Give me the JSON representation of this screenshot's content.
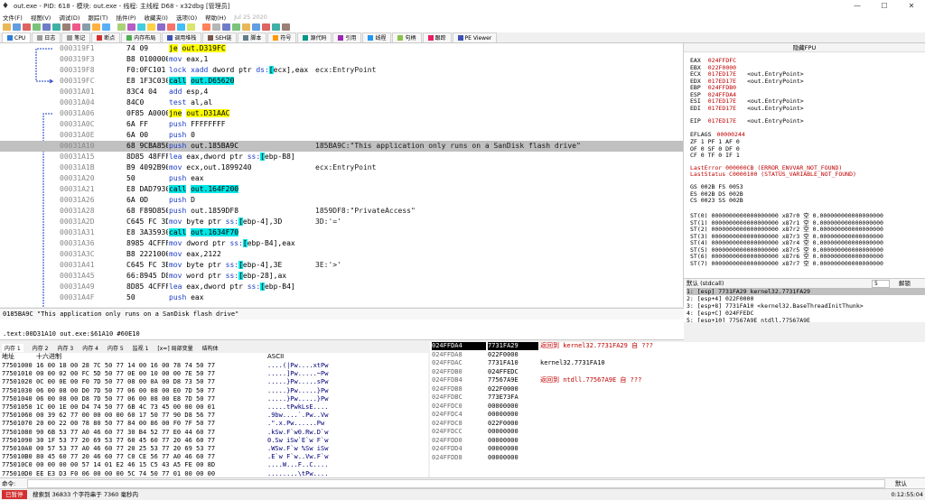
{
  "window": {
    "title": "out.exe - PID: 618 - 模块: out.exe - 线程: 主线程 D68 - x32dbg [管理员]",
    "controls": [
      "—",
      "☐",
      "✕"
    ]
  },
  "menu": {
    "items": [
      "文件(F)",
      "视图(V)",
      "调试(D)",
      "跟踪(T)",
      "插件(P)",
      "收藏夹(I)",
      "选项(O)",
      "帮助(H)"
    ],
    "date": "Jul 25 2020"
  },
  "tabs": [
    {
      "label": "CPU",
      "color": "#2e7dd7"
    },
    {
      "label": "日志",
      "color": "#9a9a9a"
    },
    {
      "label": "笔记",
      "color": "#9a9a9a"
    },
    {
      "label": "断点",
      "color": "#d32f2f"
    },
    {
      "label": "内存布局",
      "color": "#4caf50"
    },
    {
      "label": "调用堆栈",
      "color": "#3f51b5"
    },
    {
      "label": "SEH链",
      "color": "#795548"
    },
    {
      "label": "脚本",
      "color": "#607d8b"
    },
    {
      "label": "符号",
      "color": "#ff9800"
    },
    {
      "label": "源代码",
      "color": "#009688"
    },
    {
      "label": "引用",
      "color": "#9c27b0"
    },
    {
      "label": "线程",
      "color": "#2196f3"
    },
    {
      "label": "句柄",
      "color": "#8bc34a"
    },
    {
      "label": "跟踪",
      "color": "#e91e63"
    },
    {
      "label": "PE Viewer",
      "color": "#3f51b5"
    }
  ],
  "disasm": [
    {
      "addr": "000319F1",
      "bytes": "74 09",
      "instr": "je out.D319FC",
      "cmt": ""
    },
    {
      "addr": "000319F3",
      "bytes": "B8 01000000",
      "instr": "mov eax,1",
      "cmt": ""
    },
    {
      "addr": "000319F8",
      "bytes": "F0:0FC101",
      "instr": "lock xadd dword ptr ds:[ecx],eax",
      "cmt": "ecx:EntryPoint"
    },
    {
      "addr": "000319FC",
      "bytes": "E8 1F3C0300",
      "instr": "call out.D65620",
      "cmt": ""
    },
    {
      "addr": "00031A01",
      "bytes": "83C4 04",
      "instr": "add esp,4",
      "cmt": ""
    },
    {
      "addr": "00031A04",
      "bytes": "84C0",
      "instr": "test al,al",
      "cmt": ""
    },
    {
      "addr": "00031A06",
      "bytes": "0F85 A0000000",
      "instr": "jne out.D31AAC",
      "cmt": ""
    },
    {
      "addr": "00031A0C",
      "bytes": "6A FF",
      "instr": "push FFFFFFFF",
      "cmt": ""
    },
    {
      "addr": "00031A0E",
      "bytes": "6A 00",
      "instr": "push 0",
      "cmt": ""
    },
    {
      "addr": "00031A10",
      "bytes": "68 9CBA8500",
      "instr": "push out.185BA9C",
      "cmt": "185BA9C:\"This application only runs on a SanDisk flash drive\""
    },
    {
      "addr": "00031A15",
      "bytes": "8D85 48FFFFFF",
      "instr": "lea eax,dword ptr ss:[ebp-B8]",
      "cmt": ""
    },
    {
      "addr": "00031A1B",
      "bytes": "B9 4092B901",
      "instr": "mov ecx,out.1899240",
      "cmt": "ecx:EntryPoint"
    },
    {
      "addr": "00031A20",
      "bytes": "50",
      "instr": "push eax",
      "cmt": ""
    },
    {
      "addr": "00031A21",
      "bytes": "E8 DAD79300",
      "instr": "call out.164F200",
      "cmt": ""
    },
    {
      "addr": "00031A26",
      "bytes": "6A 0D",
      "instr": "push D",
      "cmt": ""
    },
    {
      "addr": "00031A28",
      "bytes": "68 F89D8501",
      "instr": "push out.1859DF8",
      "cmt": "1859DF8:\"PrivateAccess\""
    },
    {
      "addr": "00031A2D",
      "bytes": "C645 FC 3D",
      "instr": "mov byte ptr ss:[ebp-4],3D",
      "cmt": "3D:'='"
    },
    {
      "addr": "00031A31",
      "bytes": "E8 3A359300",
      "instr": "call out.1634F70",
      "cmt": ""
    },
    {
      "addr": "00031A36",
      "bytes": "8985 4CFFFFFF",
      "instr": "mov dword ptr ss:[ebp-B4],eax",
      "cmt": ""
    },
    {
      "addr": "00031A3C",
      "bytes": "B8 22210000",
      "instr": "mov eax,2122",
      "cmt": ""
    },
    {
      "addr": "00031A41",
      "bytes": "C645 FC 3E",
      "instr": "mov byte ptr ss:[ebp-4],3E",
      "cmt": "3E:'>'"
    },
    {
      "addr": "00031A45",
      "bytes": "66:8945 D8",
      "instr": "mov word ptr ss:[ebp-28],ax",
      "cmt": ""
    },
    {
      "addr": "00031A49",
      "bytes": "8D85 4CFFFFFF",
      "instr": "lea eax,dword ptr ss:[ebp-B4]",
      "cmt": ""
    },
    {
      "addr": "00031A4F",
      "bytes": "50",
      "instr": "push eax",
      "cmt": ""
    }
  ],
  "registers": {
    "header": "隐藏FPU",
    "gp": [
      {
        "name": "EAX",
        "value": "024FFDFC",
        "label": ""
      },
      {
        "name": "EBX",
        "value": "022F0000",
        "label": ""
      },
      {
        "name": "ECX",
        "value": "017ED17E",
        "label": "<out.EntryPoint>"
      },
      {
        "name": "EDX",
        "value": "017ED17E",
        "label": "<out.EntryPoint>"
      },
      {
        "name": "EBP",
        "value": "024FFDB0",
        "label": ""
      },
      {
        "name": "ESP",
        "value": "024FFDA4",
        "label": ""
      },
      {
        "name": "ESI",
        "value": "017ED17E",
        "label": "<out.EntryPoint>"
      },
      {
        "name": "EDI",
        "value": "017ED17E",
        "label": "<out.EntryPoint>"
      }
    ],
    "eip": {
      "name": "EIP",
      "value": "017ED17E",
      "label": "<out.EntryPoint>"
    },
    "eflags": {
      "name": "EFLAGS",
      "value": "00000244"
    },
    "flags": [
      "ZF 1  PF 1  AF 0",
      "OF 0  SF 0  DF 0",
      "CF 0  TF 0  IF 1"
    ],
    "lasterror": "LastError  000000CB (ERROR_ENVVAR_NOT_FOUND)",
    "laststatus": "LastStatus C0000100 (STATUS_VARIABLE_NOT_FOUND)",
    "segs": [
      "GS 002B  FS 0053",
      "ES 002B  DS 002B",
      "CS 0023  SS 002B"
    ],
    "fpu": [
      "ST(0) 0000000000000000000 x87r0 空 0.000000000000000000",
      "ST(1) 0000000000000000000 x87r1 空 0.000000000000000000",
      "ST(2) 0000000000000000000 x87r2 空 0.000000000000000000",
      "ST(3) 0000000000000000000 x87r3 空 0.000000000000000000",
      "ST(4) 0000000000000000000 x87r4 空 0.000000000000000000",
      "ST(5) 0000000000000000000 x87r5 空 0.000000000000000000",
      "ST(6) 0000000000000000000 x87r6 空 0.000000000000000000",
      "ST(7) 0000000000000000000 x87r7 空 0.000000000000000000"
    ]
  },
  "callstack": {
    "header": "默认 (stdcall)",
    "count": "5",
    "unlock": "解锁",
    "rows": [
      "1: [esp] 7731FA29 kernel32.7731FA29",
      "2: [esp+4] 022F0000",
      "3: [esp+8] 7731FA10 <kernel32.BaseThreadInitThunk>",
      "4: [esp+C] 024FFEDC",
      "5: [esp+10] 77567A9E ntdll.77567A9E"
    ]
  },
  "info": {
    "line1": "0185BA9C \"This application only runs on a SanDisk flash drive\"",
    "line2": ".text:00D31A10 out.exe:$61A10 #60E10"
  },
  "dump_tabs": [
    "内存 1",
    "内存 2",
    "内存 3",
    "内存 4",
    "内存 5",
    "监视 1",
    "[x=] 局部变量",
    "结构体"
  ],
  "dump": {
    "col_addr": "地址",
    "col_hex": "十六进制",
    "col_ascii": "ASCII",
    "rows": [
      {
        "a": "77501000",
        "h": "16 00 18 00 28 7C 50 77 14 00 16 00 78 74 50 77",
        "s": "....(|Pw....xtPw"
      },
      {
        "a": "77501010",
        "h": "00 00 02 00 FC 5D 50 77 0E 00 10 00 00 7E 50 77",
        "s": ".....]Pw.....~Pw"
      },
      {
        "a": "77501020",
        "h": "0C 00 0E 00 F0 7D 50 77 08 00 0A 00 D8 73 50 77",
        "s": ".....}Pw.....sPw"
      },
      {
        "a": "77501030",
        "h": "06 00 08 00 D0 7D 50 77 06 00 08 00 E0 7D 50 77",
        "s": ".....}Pw.....}Pw"
      },
      {
        "a": "77501040",
        "h": "06 00 08 00 D8 7D 50 77 06 00 08 00 E8 7D 50 77",
        "s": ".....}Pw.....}Pw"
      },
      {
        "a": "77501050",
        "h": "1C 00 1E 00 D4 74 50 77 6B 4C 73 45 00 00 00 01",
        "s": ".....tPwkLsE...."
      },
      {
        "a": "77501060",
        "h": "00 39 62 77 00 00 00 00 60 17 50 77 90 D8 56 77",
        "s": ".9bw....`.Pw..Vw"
      },
      {
        "a": "77501070",
        "h": "20 00 22 00 78 80 50 77 84 00 86 00 F0 7F 50 77",
        "s": " .\".x.Pw......Pw"
      },
      {
        "a": "77501080",
        "h": "90 6B 53 77 A0 46 60 77 30 B4 52 77 E0 44 60 77",
        "s": ".kSw.F`w0.Rw.D`w"
      },
      {
        "a": "77501090",
        "h": "30 1F 53 77 20 69 53 77 60 45 60 77 20 46 60 77",
        "s": "0.Sw iSw`E`w F`w"
      },
      {
        "a": "775010A0",
        "h": "00 57 53 77 A0 46 60 77 20 25 53 77 20 69 53 77",
        "s": ".WSw.F`w %Sw iSw"
      },
      {
        "a": "775010B0",
        "h": "80 45 60 77 20 46 60 77 C0 CE 56 77 A0 46 60 77",
        "s": ".E`w F`w..Vw.F`w"
      },
      {
        "a": "775010C0",
        "h": "00 00 00 00 57 14 01 E2 46 15 C5 43 A5 FE 00 8D",
        "s": "....W...F..C...."
      },
      {
        "a": "775010D0",
        "h": "EE E3 D3 F0 06 00 00 00 5C 74 50 77 01 00 00 00",
        "s": "........\\tPw...."
      }
    ]
  },
  "stack": [
    {
      "a": "024FFDA4",
      "v": "7731FA29",
      "c": "返回到 kernel32.7731FA29 自 ???"
    },
    {
      "a": "024FFDA8",
      "v": "022F0000",
      "c": ""
    },
    {
      "a": "024FFDAC",
      "v": "7731FA10",
      "c": "kernel32.7731FA10"
    },
    {
      "a": "024FFDB0",
      "v": "024FFEDC",
      "c": ""
    },
    {
      "a": "024FFDB4",
      "v": "77567A9E",
      "c": "返回到 ntdll.77567A9E 自 ???"
    },
    {
      "a": "024FFDB8",
      "v": "022F0000",
      "c": ""
    },
    {
      "a": "024FFDBC",
      "v": "773E73FA",
      "c": ""
    },
    {
      "a": "024FFDC0",
      "v": "00000000",
      "c": ""
    },
    {
      "a": "024FFDC4",
      "v": "00000000",
      "c": ""
    },
    {
      "a": "024FFDC8",
      "v": "022F0000",
      "c": ""
    },
    {
      "a": "024FFDCC",
      "v": "00000000",
      "c": ""
    },
    {
      "a": "024FFDD0",
      "v": "00000000",
      "c": ""
    },
    {
      "a": "024FFDD4",
      "v": "00000000",
      "c": ""
    },
    {
      "a": "024FFDD8",
      "v": "00000000",
      "c": ""
    }
  ],
  "command": {
    "label": "命令:",
    "default": "默认"
  },
  "status": {
    "state": "已暂停",
    "message": "搜索到 36833 个字符串于 7360 毫秒内",
    "time": "0:12:55:04"
  },
  "colors": {
    "call_bg": "#00e6e6",
    "jump_bg": "#ffff00",
    "selected_row": "#c0c0c0",
    "register_value": "#c00000",
    "paused": "#d32f2f"
  }
}
